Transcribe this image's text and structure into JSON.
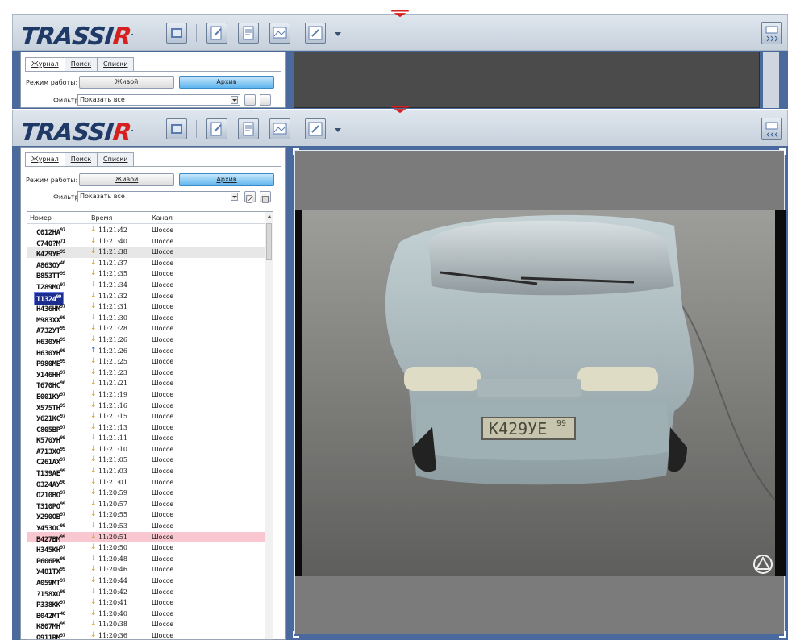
{
  "brand": {
    "logo_main": "TRASSI",
    "logo_r": "R",
    "logo_dot": "."
  },
  "tabs": [
    {
      "label": "Журнал",
      "active": true
    },
    {
      "label": "Поиск",
      "active": false
    },
    {
      "label": "Списки",
      "active": false
    }
  ],
  "mode": {
    "label": "Режим работы:",
    "live": "Живой",
    "archive": "Архив",
    "active": "archive"
  },
  "filter": {
    "label": "Фильтр:",
    "value": "Показать все"
  },
  "table": {
    "columns": [
      "Номер",
      "Время",
      "Канал"
    ],
    "rows": [
      {
        "plate": "С012НА",
        "region": "97",
        "dir": "down",
        "time": "11:21:42",
        "channel": "Шоссе"
      },
      {
        "plate": "С740?М",
        "region": "71",
        "dir": "down",
        "time": "11:21:40",
        "channel": "Шоссе"
      },
      {
        "plate": "К429УЕ",
        "region": "99",
        "dir": "down",
        "time": "11:21:38",
        "channel": "Шоссе",
        "state": "gray"
      },
      {
        "plate": "А863ОУ",
        "region": "40",
        "dir": "down",
        "time": "11:21:37",
        "channel": "Шоссе"
      },
      {
        "plate": "В853ТТ",
        "region": "99",
        "dir": "down",
        "time": "11:21:35",
        "channel": "Шоссе"
      },
      {
        "plate": "Т289МО",
        "region": "97",
        "dir": "down",
        "time": "11:21:34",
        "channel": "Шоссе"
      },
      {
        "plate": "Т1324",
        "region": "99",
        "dir": "down",
        "time": "11:21:32",
        "channel": "Шоссе",
        "state": "plate-hl"
      },
      {
        "plate": "Н436НМ",
        "region": "97",
        "dir": "down",
        "time": "11:21:31",
        "channel": "Шоссе"
      },
      {
        "plate": "М983ХХ",
        "region": "99",
        "dir": "down",
        "time": "11:21:30",
        "channel": "Шоссе"
      },
      {
        "plate": "А732УТ",
        "region": "99",
        "dir": "down",
        "time": "11:21:28",
        "channel": "Шоссе"
      },
      {
        "plate": "Н630УН",
        "region": "99",
        "dir": "down",
        "time": "11:21:26",
        "channel": "Шоссе"
      },
      {
        "plate": "Н630УН",
        "region": "99",
        "dir": "up",
        "time": "11:21:26",
        "channel": "Шоссе"
      },
      {
        "plate": "Р980МЕ",
        "region": "99",
        "dir": "down",
        "time": "11:21:25",
        "channel": "Шоссе"
      },
      {
        "plate": "У146НН",
        "region": "97",
        "dir": "down",
        "time": "11:21:23",
        "channel": "Шоссе"
      },
      {
        "plate": "Т670НС",
        "region": "90",
        "dir": "down",
        "time": "11:21:21",
        "channel": "Шоссе"
      },
      {
        "plate": "Е001КУ",
        "region": "97",
        "dir": "down",
        "time": "11:21:19",
        "channel": "Шоссе"
      },
      {
        "plate": "Х575ТН",
        "region": "99",
        "dir": "down",
        "time": "11:21:16",
        "channel": "Шоссе"
      },
      {
        "plate": "У621КС",
        "region": "97",
        "dir": "down",
        "time": "11:21:15",
        "channel": "Шоссе"
      },
      {
        "plate": "С805ВР",
        "region": "97",
        "dir": "down",
        "time": "11:21:13",
        "channel": "Шоссе"
      },
      {
        "plate": "К570УН",
        "region": "99",
        "dir": "down",
        "time": "11:21:11",
        "channel": "Шоссе"
      },
      {
        "plate": "А713ХО",
        "region": "99",
        "dir": "down",
        "time": "11:21:10",
        "channel": "Шоссе"
      },
      {
        "plate": "С261АХ",
        "region": "97",
        "dir": "down",
        "time": "11:21:05",
        "channel": "Шоссе"
      },
      {
        "plate": "Т139АЕ",
        "region": "99",
        "dir": "down",
        "time": "11:21:03",
        "channel": "Шоссе"
      },
      {
        "plate": "О324АУ",
        "region": "90",
        "dir": "down",
        "time": "11:21:01",
        "channel": "Шоссе"
      },
      {
        "plate": "О210ВО",
        "region": "97",
        "dir": "down",
        "time": "11:20:59",
        "channel": "Шоссе"
      },
      {
        "plate": "Т310РО",
        "region": "99",
        "dir": "down",
        "time": "11:20:57",
        "channel": "Шоссе"
      },
      {
        "plate": "У290ОВ",
        "region": "97",
        "dir": "down",
        "time": "11:20:55",
        "channel": "Шоссе"
      },
      {
        "plate": "У453ОС",
        "region": "99",
        "dir": "down",
        "time": "11:20:53",
        "channel": "Шоссе"
      },
      {
        "plate": "В427ВМ",
        "region": "99",
        "dir": "down",
        "time": "11:20:51",
        "channel": "Шоссе",
        "state": "pink"
      },
      {
        "plate": "Н345КН",
        "region": "97",
        "dir": "down",
        "time": "11:20:50",
        "channel": "Шоссе"
      },
      {
        "plate": "Р606РК",
        "region": "99",
        "dir": "down",
        "time": "11:20:48",
        "channel": "Шоссе"
      },
      {
        "plate": "У481ТХ",
        "region": "99",
        "dir": "down",
        "time": "11:20:46",
        "channel": "Шоссе"
      },
      {
        "plate": "А059МТ",
        "region": "97",
        "dir": "down",
        "time": "11:20:44",
        "channel": "Шоссе"
      },
      {
        "plate": "?158ХО",
        "region": "99",
        "dir": "down",
        "time": "11:20:42",
        "channel": "Шоссе"
      },
      {
        "plate": "Р338КК",
        "region": "97",
        "dir": "down",
        "time": "11:20:41",
        "channel": "Шоссе"
      },
      {
        "plate": "В042МТ",
        "region": "40",
        "dir": "down",
        "time": "11:20:40",
        "channel": "Шоссе"
      },
      {
        "plate": "К807МН",
        "region": "99",
        "dir": "down",
        "time": "11:20:38",
        "channel": "Шоссе"
      },
      {
        "plate": "О911ВМ",
        "region": "97",
        "dir": "down",
        "time": "11:20:36",
        "channel": "Шоссе"
      }
    ]
  },
  "video": {
    "plate_text": "К429УЕ",
    "plate_region": "99"
  },
  "icons": [
    "film-icon",
    "edit-icon",
    "report-icon",
    "image-icon",
    "settings-icon",
    "expand-panel-icon",
    "collapse-panel-icon"
  ],
  "colors": {
    "accent_blue": "#4b6a9c",
    "active_button": "#5fb5ee",
    "highlight_plate": "#1b2d8f",
    "pink_row": "#f8c7cf",
    "logo_red": "#d6201f"
  }
}
